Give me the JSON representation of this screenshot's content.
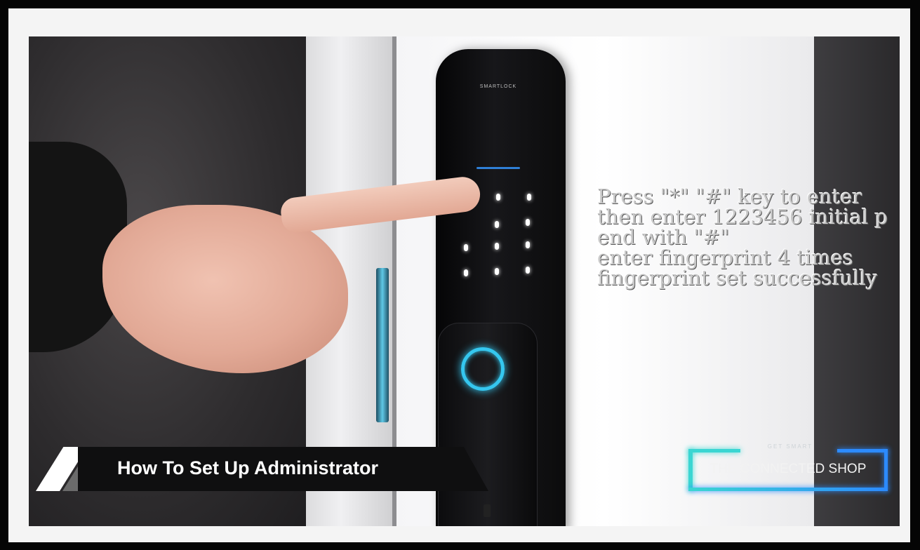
{
  "lower_third": {
    "title": "How To Set Up Administrator"
  },
  "instructions": {
    "lines": [
      "Press \"*\" \"#\"   key to enter",
      "then enter 1223456 initial p",
      "end with \"#\"",
      "enter fingerprint  4 times",
      "fingerprint set successfully"
    ]
  },
  "logo": {
    "tagline": "GET SMART",
    "name": "THE CONNECTED SHOP"
  },
  "lock": {
    "brand": "SMARTLOCK"
  },
  "colors": {
    "accent_cyan": "#3ad6d2",
    "accent_blue": "#2c8bff",
    "fingerprint_ring": "#35c7ef"
  }
}
